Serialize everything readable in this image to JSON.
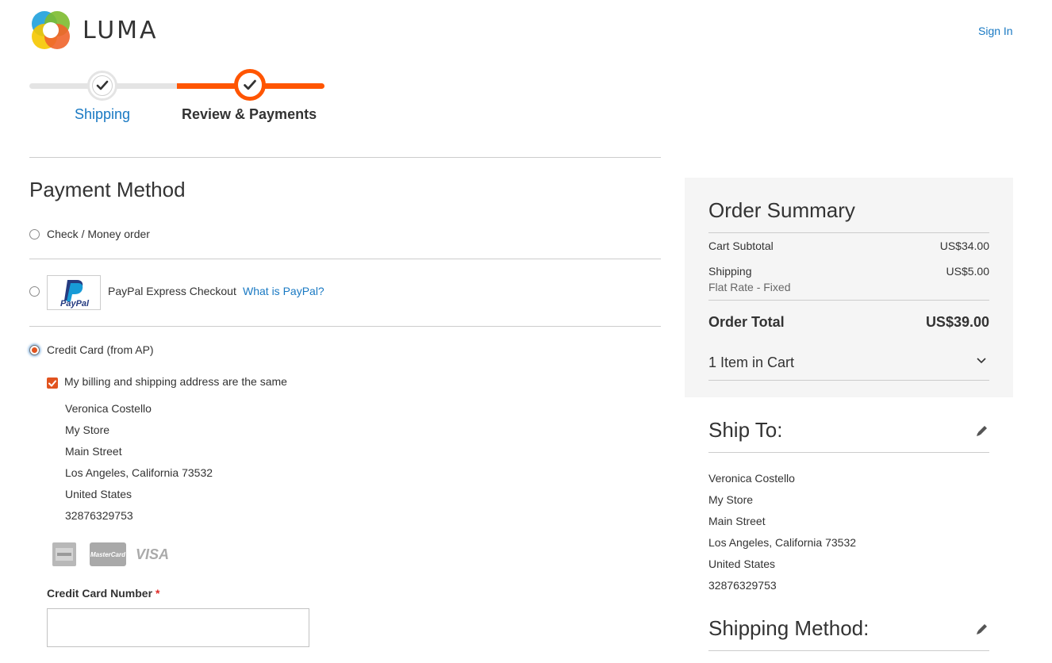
{
  "header": {
    "logo_text": "LUMA",
    "sign_in": "Sign In"
  },
  "progress": {
    "steps": [
      {
        "label": "Shipping",
        "state": "complete"
      },
      {
        "label": "Review & Payments",
        "state": "active"
      }
    ]
  },
  "payment": {
    "title": "Payment Method",
    "options": [
      {
        "label": "Check / Money order",
        "selected": false
      },
      {
        "label": "PayPal Express Checkout",
        "link": "What is PayPal?",
        "logo_text": "PayPal",
        "selected": false
      },
      {
        "label": "Credit Card (from AP)",
        "selected": true
      }
    ],
    "same_address_label": "My billing and shipping address are the same",
    "same_address_checked": true,
    "billing_address": {
      "name": "Veronica Costello",
      "company": "My Store",
      "street": "Main Street",
      "city_line": "Los Angeles, California 73532",
      "country": "United States",
      "phone": "32876329753"
    },
    "card_types": {
      "mastercard": "MasterCard",
      "visa": "VISA"
    },
    "cc_number_label": "Credit Card Number",
    "required_mark": "*",
    "cc_number_value": ""
  },
  "summary": {
    "title": "Order Summary",
    "cart_subtotal_label": "Cart Subtotal",
    "cart_subtotal_value": "US$34.00",
    "shipping_label": "Shipping",
    "shipping_value": "US$5.00",
    "shipping_method": "Flat Rate - Fixed",
    "order_total_label": "Order Total",
    "order_total_value": "US$39.00",
    "items_in_cart": "1 Item in Cart"
  },
  "ship_to": {
    "title": "Ship To:",
    "address": {
      "name": "Veronica Costello",
      "company": "My Store",
      "street": "Main Street",
      "city_line": "Los Angeles, California 73532",
      "country": "United States",
      "phone": "32876329753"
    }
  },
  "shipping_method_block": {
    "title": "Shipping Method:"
  },
  "colors": {
    "accent": "#ff5501",
    "link": "#1979c3",
    "checked": "#e1531f",
    "summary_bg": "#f5f5f5"
  }
}
